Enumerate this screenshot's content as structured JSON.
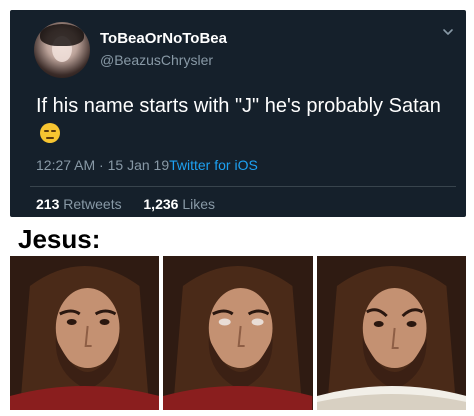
{
  "tweet": {
    "display_name": "ToBeaOrNoToBea",
    "handle": "@BeazusChrysler",
    "text": "If his name starts with \"J\" he's probably Satan",
    "emoji_icon": "unamused-face-icon",
    "time": "12:27 AM",
    "separator": "·",
    "date": "15 Jan 19",
    "client": "Twitter for iOS",
    "retweets_count": "213",
    "retweets_label": "Retweets",
    "likes_count": "1,236",
    "likes_label": "Likes"
  },
  "meme": {
    "caption": "Jesus:",
    "panels": [
      {
        "expression": "neutral"
      },
      {
        "expression": "eyes-rolled-back"
      },
      {
        "expression": "sad"
      }
    ]
  },
  "colors": {
    "tweet_bg": "#15202b",
    "secondary_text": "#8899a6",
    "link": "#1da1f2",
    "divider": "#38444d"
  }
}
